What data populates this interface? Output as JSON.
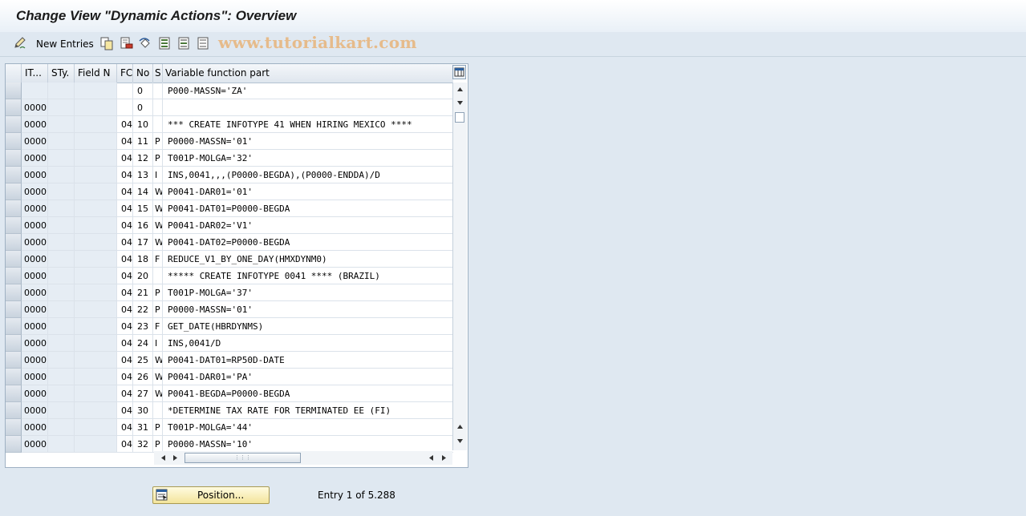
{
  "window": {
    "title": "Change View \"Dynamic Actions\": Overview"
  },
  "toolbar": {
    "new_entries_label": "New Entries",
    "watermark": "www.tutorialkart.com",
    "icons": [
      "edit-pencil-icon",
      "copy-icon",
      "delete-icon",
      "undo-icon",
      "select-all-icon",
      "select-block-icon",
      "deselect-all-icon"
    ]
  },
  "table": {
    "columns": [
      "IT...",
      "STy.",
      "Field N",
      "FC",
      "No",
      "S",
      "Variable function part"
    ],
    "rows": [
      {
        "it": "",
        "sty": "",
        "field": "",
        "fc": "",
        "no": "0",
        "s": "",
        "var": "P000-MASSN='ZA'"
      },
      {
        "it": "0000",
        "sty": "",
        "field": "",
        "fc": "",
        "no": "0",
        "s": "",
        "var": ""
      },
      {
        "it": "0000",
        "sty": "",
        "field": "",
        "fc": "04",
        "no": "10",
        "s": "",
        "var": "*** CREATE INFOTYPE 41 WHEN HIRING  MEXICO ****"
      },
      {
        "it": "0000",
        "sty": "",
        "field": "",
        "fc": "04",
        "no": "11",
        "s": "P",
        "var": "P0000-MASSN='01'"
      },
      {
        "it": "0000",
        "sty": "",
        "field": "",
        "fc": "04",
        "no": "12",
        "s": "P",
        "var": "T001P-MOLGA='32'"
      },
      {
        "it": "0000",
        "sty": "",
        "field": "",
        "fc": "04",
        "no": "13",
        "s": "I",
        "var": "INS,0041,,,(P0000-BEGDA),(P0000-ENDDA)/D"
      },
      {
        "it": "0000",
        "sty": "",
        "field": "",
        "fc": "04",
        "no": "14",
        "s": "W",
        "var": "P0041-DAR01='01'"
      },
      {
        "it": "0000",
        "sty": "",
        "field": "",
        "fc": "04",
        "no": "15",
        "s": "W",
        "var": "P0041-DAT01=P0000-BEGDA"
      },
      {
        "it": "0000",
        "sty": "",
        "field": "",
        "fc": "04",
        "no": "16",
        "s": "W",
        "var": "P0041-DAR02='V1'"
      },
      {
        "it": "0000",
        "sty": "",
        "field": "",
        "fc": "04",
        "no": "17",
        "s": "W",
        "var": "P0041-DAT02=P0000-BEGDA"
      },
      {
        "it": "0000",
        "sty": "",
        "field": "",
        "fc": "04",
        "no": "18",
        "s": "F",
        "var": "REDUCE_V1_BY_ONE_DAY(HMXDYNM0)"
      },
      {
        "it": "0000",
        "sty": "",
        "field": "",
        "fc": "04",
        "no": "20",
        "s": "",
        "var": "***** CREATE INFOTYPE 0041 **** (BRAZIL)"
      },
      {
        "it": "0000",
        "sty": "",
        "field": "",
        "fc": "04",
        "no": "21",
        "s": "P",
        "var": "T001P-MOLGA='37'"
      },
      {
        "it": "0000",
        "sty": "",
        "field": "",
        "fc": "04",
        "no": "22",
        "s": "P",
        "var": "P0000-MASSN='01'"
      },
      {
        "it": "0000",
        "sty": "",
        "field": "",
        "fc": "04",
        "no": "23",
        "s": "F",
        "var": "GET_DATE(HBRDYNMS)"
      },
      {
        "it": "0000",
        "sty": "",
        "field": "",
        "fc": "04",
        "no": "24",
        "s": "I",
        "var": "INS,0041/D"
      },
      {
        "it": "0000",
        "sty": "",
        "field": "",
        "fc": "04",
        "no": "25",
        "s": "W",
        "var": "P0041-DAT01=RP50D-DATE"
      },
      {
        "it": "0000",
        "sty": "",
        "field": "",
        "fc": "04",
        "no": "26",
        "s": "W",
        "var": "P0041-DAR01='PA'"
      },
      {
        "it": "0000",
        "sty": "",
        "field": "",
        "fc": "04",
        "no": "27",
        "s": "W",
        "var": "P0041-BEGDA=P0000-BEGDA"
      },
      {
        "it": "0000",
        "sty": "",
        "field": "",
        "fc": "04",
        "no": "30",
        "s": "",
        "var": "*DETERMINE TAX RATE FOR TERMINATED EE (FI)"
      },
      {
        "it": "0000",
        "sty": "",
        "field": "",
        "fc": "04",
        "no": "31",
        "s": "P",
        "var": "T001P-MOLGA='44'"
      },
      {
        "it": "0000",
        "sty": "",
        "field": "",
        "fc": "04",
        "no": "32",
        "s": "P",
        "var": "P0000-MASSN='10'"
      }
    ]
  },
  "footer": {
    "position_label": "Position...",
    "entry_info": "Entry 1 of 5.288"
  }
}
